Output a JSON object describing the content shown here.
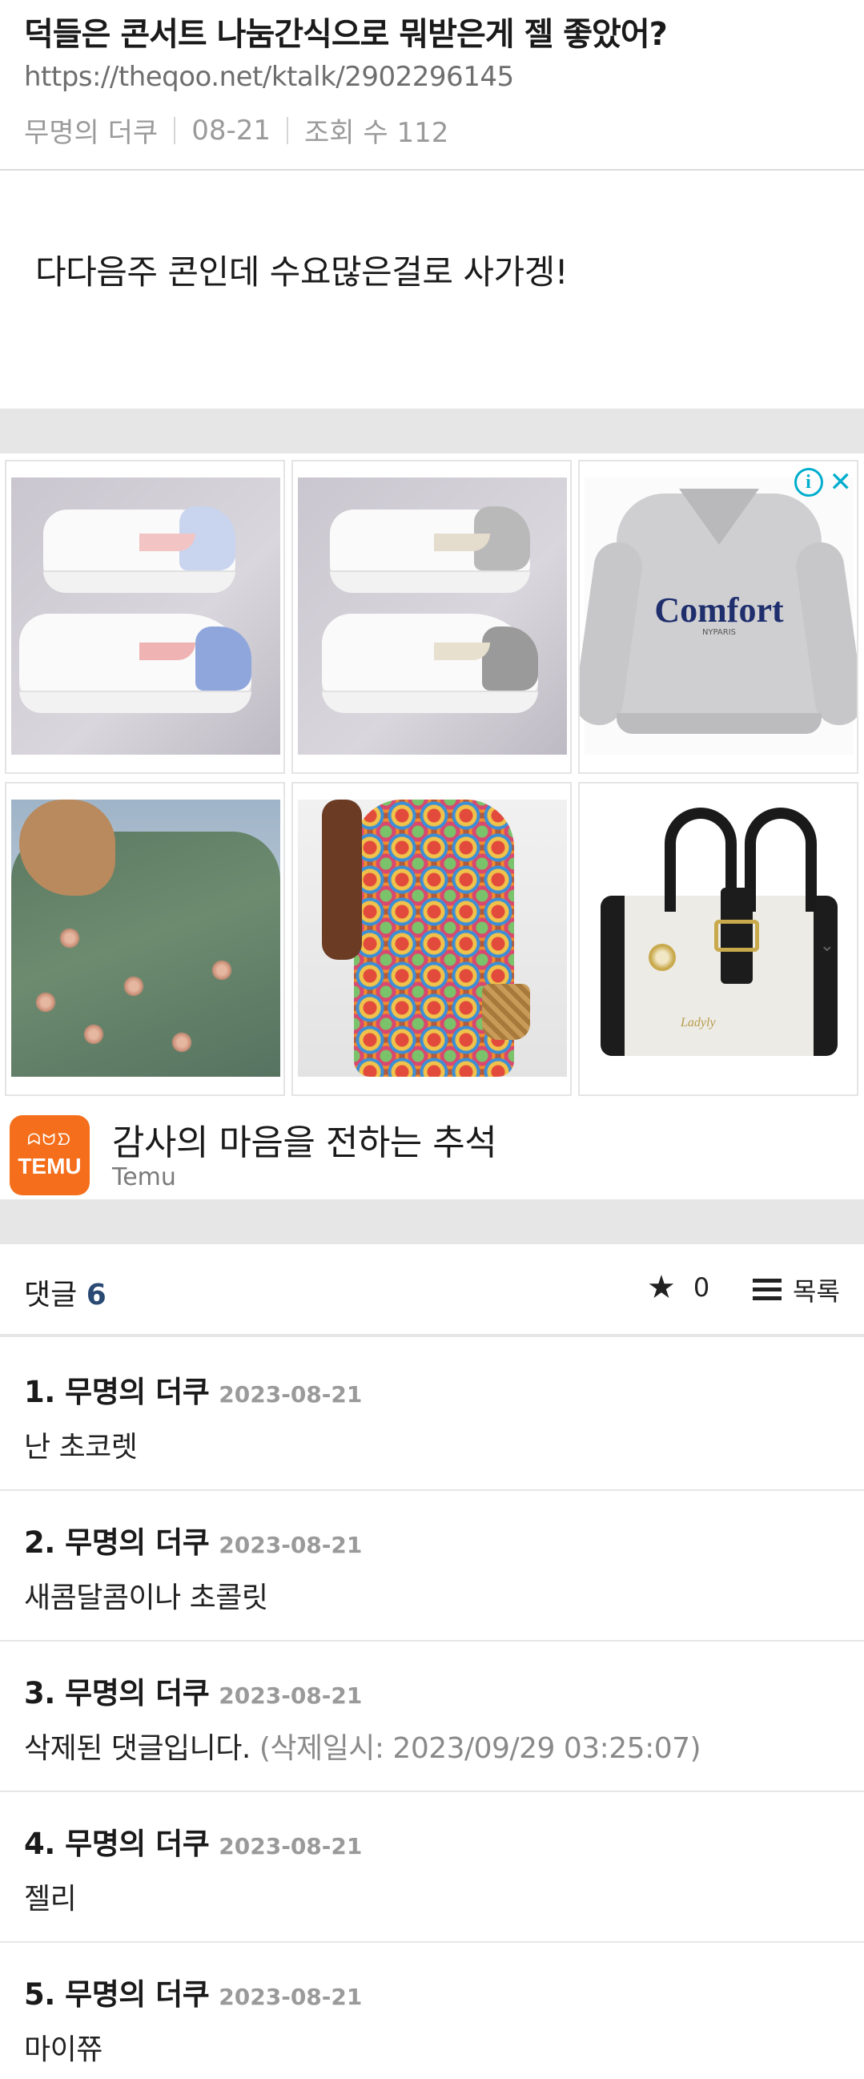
{
  "post": {
    "title": "덕들은 콘서트 나눔간식으로 뭐받은게 젤 좋았어?",
    "url": "https://theqoo.net/ktalk/2902296145",
    "author": "무명의 더쿠",
    "date": "08-21",
    "views": "조회 수 112",
    "body": "다다음주 콘인데 수요많은걸로 사가겡!"
  },
  "ad": {
    "title": "감사의 마음을 전하는 추석",
    "brand": "Temu",
    "logo_text": "TEMU",
    "logo_glyphs": "ᗣᗢᗤ",
    "info_icon": "i",
    "close_icon": "✕",
    "bag_logo": "Ladyly",
    "sweater_word": "Comfort",
    "sweater_sub": "NYPARIS",
    "chevron": "⌄",
    "brand_color": "#f46e1b",
    "adchoice_color": "#00aecd"
  },
  "comments_header": {
    "label": "댓글",
    "count": "6",
    "star_icon": "★",
    "star_count": "0",
    "list_label": "목록"
  },
  "comments": [
    {
      "author": "1. 무명의 더쿠",
      "date": "2023-08-21",
      "text": "난 초코렛"
    },
    {
      "author": "2. 무명의 더쿠",
      "date": "2023-08-21",
      "text": "새콤달콤이나 초콜릿"
    },
    {
      "author": "3. 무명의 더쿠",
      "date": "2023-08-21",
      "text": "삭제된 댓글입니다.",
      "note": "(삭제일시: 2023/09/29 03:25:07)"
    },
    {
      "author": "4. 무명의 더쿠",
      "date": "2023-08-21",
      "text": "젤리"
    },
    {
      "author": "5. 무명의 더쿠",
      "date": "2023-08-21",
      "text": "마이쮸"
    }
  ]
}
